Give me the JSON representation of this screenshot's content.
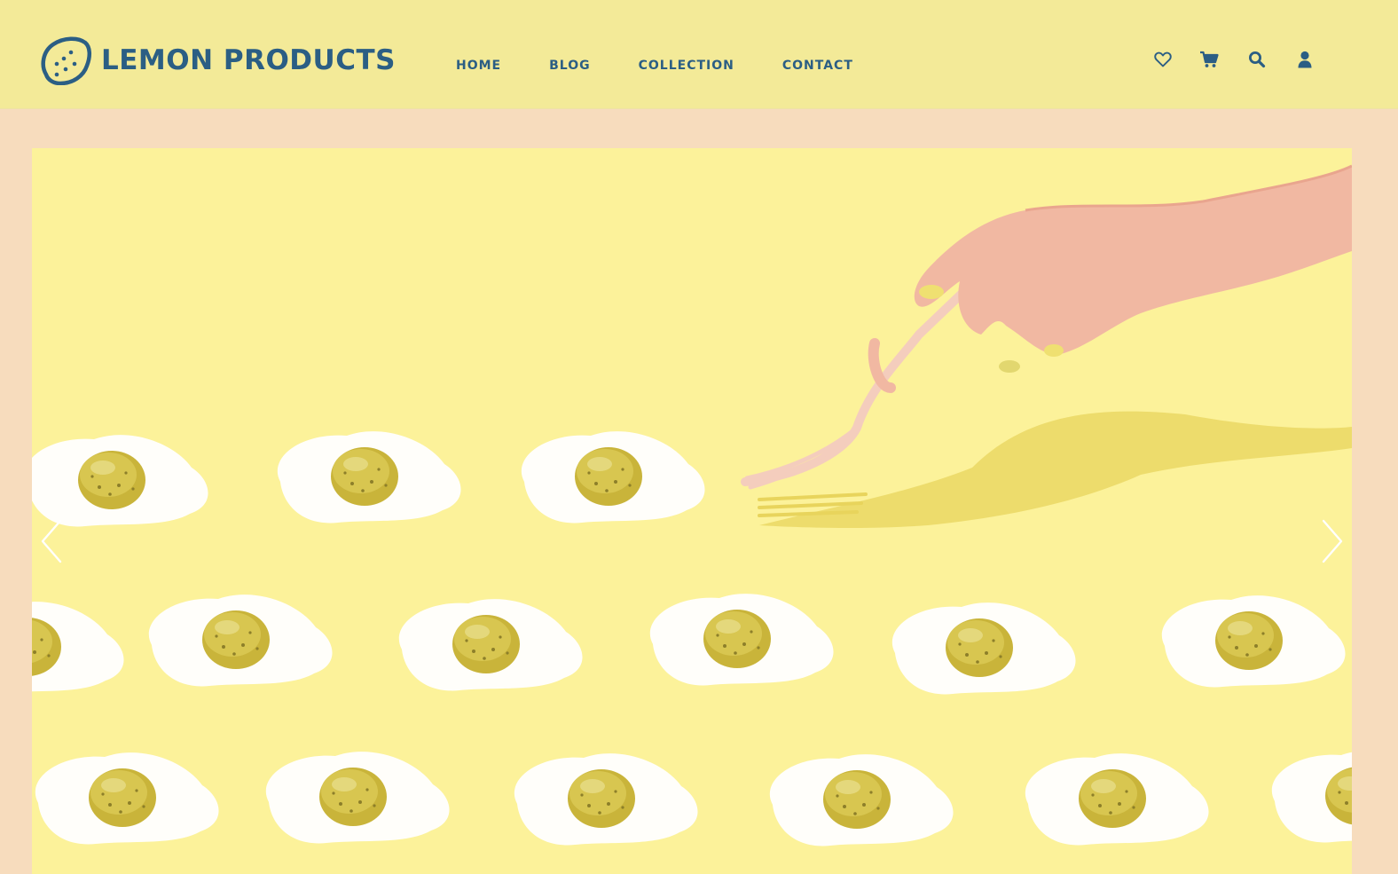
{
  "brand": {
    "name": "LEMON PRODUCTS",
    "logo_icon": "lemon-icon",
    "color": "#2b5e84"
  },
  "nav": {
    "items": [
      {
        "label": "HOME"
      },
      {
        "label": "BLOG"
      },
      {
        "label": "COLLECTION"
      },
      {
        "label": "CONTACT"
      }
    ]
  },
  "header_icons": [
    "heart-icon",
    "cart-icon",
    "search-icon",
    "user-icon"
  ],
  "colors": {
    "header_bg": "#f3ea98",
    "page_bg": "#f7dcbd",
    "hero_bg": "#fcf29a",
    "accent": "#2b5e84"
  },
  "slider": {
    "prev_icon": "chevron-left-icon",
    "next_icon": "chevron-right-icon"
  }
}
